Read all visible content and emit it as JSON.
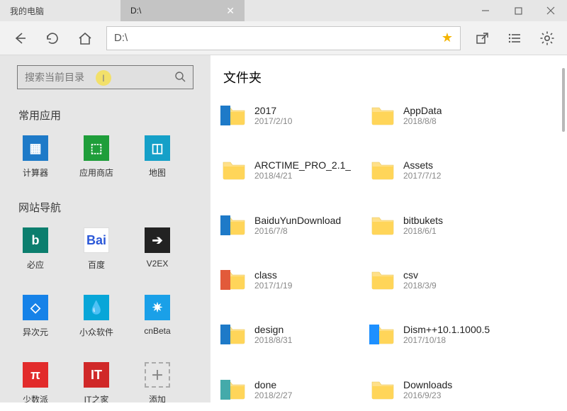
{
  "titlebar": {
    "tabs": [
      {
        "label": "我的电脑"
      },
      {
        "label": "D:\\"
      }
    ]
  },
  "toolbar": {
    "address": "D:\\"
  },
  "sidebar": {
    "search_placeholder": "搜索当前目录",
    "section_apps": "常用应用",
    "section_sites": "网站导航",
    "apps": [
      {
        "label": "计算器",
        "bg": "#1e7ac8",
        "glyph": "▦"
      },
      {
        "label": "应用商店",
        "bg": "#1f9e3a",
        "glyph": "⬚"
      },
      {
        "label": "地图",
        "bg": "#15a0c8",
        "glyph": "◫"
      }
    ],
    "sites": [
      {
        "label": "必应",
        "bg": "#0c7e6e",
        "glyph": "b"
      },
      {
        "label": "百度",
        "bg": "#ffffff",
        "glyph": "Bai",
        "fg": "#2b58d8",
        "border": "1px solid #ddd"
      },
      {
        "label": "V2EX",
        "bg": "#222222",
        "glyph": "➔"
      },
      {
        "label": "异次元",
        "bg": "#1682e8",
        "glyph": "◇"
      },
      {
        "label": "小众软件",
        "bg": "#08a6d8",
        "glyph": "💧"
      },
      {
        "label": "cnBeta",
        "bg": "#1aa0e8",
        "glyph": "✷"
      },
      {
        "label": "少数派",
        "bg": "#e22b2b",
        "glyph": "π"
      },
      {
        "label": "IT之家",
        "bg": "#d02828",
        "glyph": "IT"
      },
      {
        "label": "添加",
        "bg": "transparent",
        "glyph": "＋",
        "klass": "add"
      }
    ]
  },
  "content": {
    "heading": "文件夹",
    "folders": [
      {
        "name": "2017",
        "date": "2017/2/10",
        "deco": "#1e7ac8"
      },
      {
        "name": "AppData",
        "date": "2018/8/8",
        "deco": null
      },
      {
        "name": "ARCTIME_PRO_2.1_",
        "date": "2018/4/21",
        "deco": null
      },
      {
        "name": "Assets",
        "date": "2017/7/12",
        "deco": null
      },
      {
        "name": "BaiduYunDownload",
        "date": "2016/7/8",
        "deco": "#1e7ac8"
      },
      {
        "name": "bitbukets",
        "date": "2018/6/1",
        "deco": null
      },
      {
        "name": "class",
        "date": "2017/1/19",
        "deco": "#e25a3a"
      },
      {
        "name": "csv",
        "date": "2018/3/9",
        "deco": null
      },
      {
        "name": "design",
        "date": "2018/8/31",
        "deco": "#1e7ac8"
      },
      {
        "name": "Dism++10.1.1000.5",
        "date": "2017/10/18",
        "deco": "#1e90ff"
      },
      {
        "name": "done",
        "date": "2018/2/27",
        "deco": "#4aa"
      },
      {
        "name": "Downloads",
        "date": "2016/9/23",
        "deco": null
      }
    ]
  }
}
